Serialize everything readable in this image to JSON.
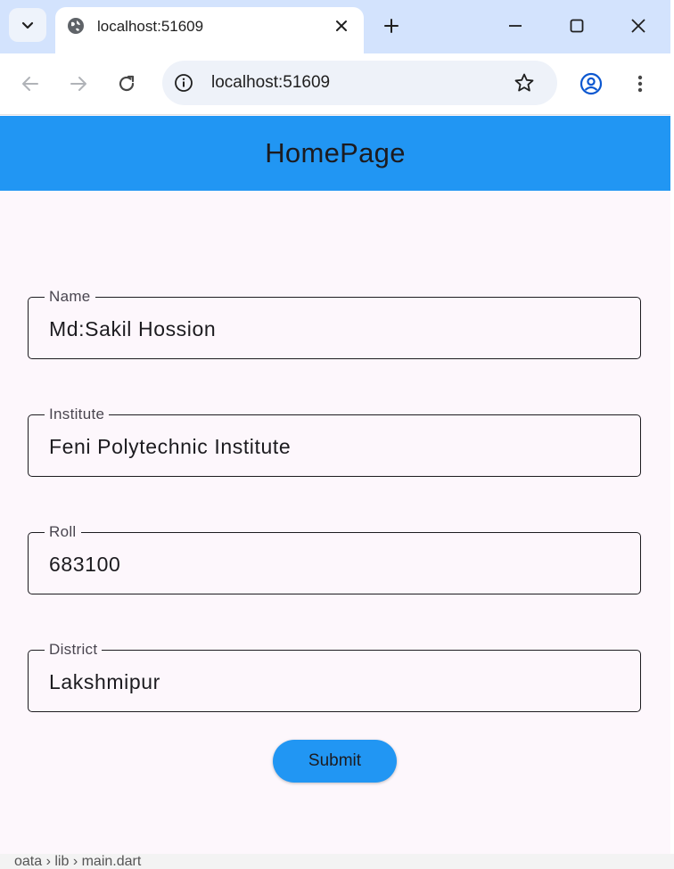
{
  "browser": {
    "tab_title": "localhost:51609",
    "url": "localhost:51609",
    "icons": {
      "tab_search": "chevron-down-icon",
      "favicon": "globe-icon",
      "close": "close-icon",
      "new_tab": "plus-icon",
      "minimize": "minimize-icon",
      "maximize": "maximize-icon",
      "window_close": "close-icon",
      "back": "arrow-left-icon",
      "forward": "arrow-right-icon",
      "reload": "reload-icon",
      "site_info": "info-icon",
      "bookmark": "star-icon",
      "profile": "profile-icon",
      "menu": "more-vertical-icon"
    }
  },
  "app": {
    "title": "HomePage",
    "accent_color": "#2196f3",
    "background_color": "#fdf7fc"
  },
  "form": {
    "fields": [
      {
        "label": "Name",
        "value": "Md:Sakil Hossion"
      },
      {
        "label": "Institute",
        "value": "Feni Polytechnic Institute"
      },
      {
        "label": "Roll",
        "value": "683100"
      },
      {
        "label": "District",
        "value": "Lakshmipur"
      }
    ],
    "submit_label": "Submit"
  },
  "background_window": {
    "breadcrumb": "oata  ›  lib  ›  main.dart"
  }
}
